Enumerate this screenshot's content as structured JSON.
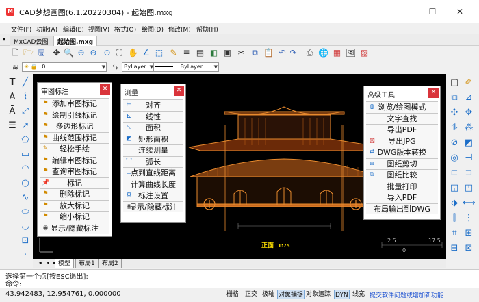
{
  "window": {
    "title": "CAD梦想画图(6.1.20220304) - 起始图.mxg",
    "minimize": "—",
    "maximize": "☐",
    "close": "✕"
  },
  "menu": [
    "文件(F)",
    "功能(A)",
    "编辑(E)",
    "视图(V)",
    "格式(O)",
    "绘图(D)",
    "修改(M)",
    "帮助(H)"
  ],
  "doc_tabs": [
    "MxCAD云图",
    "起始图.mxg"
  ],
  "layer_bar": {
    "layer_value": "0",
    "color_value": "ByLayer",
    "linetype_value": "ByLayer"
  },
  "panels": {
    "review": {
      "title": "审图标注",
      "items": [
        "添加审图标记",
        "绘制引线标记",
        "多边形标记",
        "曲线范围标记",
        "轻松手绘",
        "编辑审图标记",
        "查询审图标记",
        "标记",
        "删除标记",
        "放大标记",
        "缩小标记",
        "显示/隐藏标注"
      ]
    },
    "measure": {
      "title": "测量",
      "items": [
        "对齐",
        "线性",
        "面积",
        "矩形面积",
        "连续测量",
        "弧长",
        "点到直线距离",
        "计算曲线长度",
        "标注设置",
        "显示/隐藏标注"
      ]
    },
    "advanced": {
      "title": "高级工具",
      "items": [
        "浏览/绘图模式",
        "文字查找",
        "导出PDF",
        "导出JPG",
        "DWG版本转换",
        "图纸剪切",
        "图纸比较",
        "批量打印",
        "导入PDF",
        "布局输出到DWG"
      ]
    }
  },
  "drawing": {
    "label": "正面",
    "scale": "1:75",
    "scale_ticks": [
      "2.5",
      "0",
      "17.5"
    ]
  },
  "layout_tabs": [
    "模型",
    "布局1",
    "布局2"
  ],
  "command": {
    "history": "选择第一个点[按ESC退出]:",
    "prompt": "命令:"
  },
  "status": {
    "coords": "43.942483,  12.954761,  0.000000",
    "toggles": [
      {
        "label": "栅格",
        "on": false
      },
      {
        "label": "正交",
        "on": false
      },
      {
        "label": "极轴",
        "on": false
      },
      {
        "label": "对象捕捉",
        "on": true
      },
      {
        "label": "对象追踪",
        "on": false
      },
      {
        "label": "DYN",
        "on": true
      },
      {
        "label": "线宽",
        "on": false
      }
    ],
    "promo": "提交软件问题或增加新功能"
  },
  "colors": {
    "canvas_bg": "#000000",
    "drawing_orange": "#e88a2e",
    "drawing_label": "#ffdf00",
    "close_button": "#d9343b",
    "promo_link": "#1a4fd1"
  },
  "icons": {
    "app": "cad-logo-icon",
    "tools_left": [
      "text-icon",
      "line-icon",
      "paragraph-icon",
      "polyline-icon",
      "rectangle-icon",
      "arc-icon",
      "circle-icon",
      "spline-icon",
      "ellipse-icon",
      "hatch-icon",
      "insert-icon",
      "point-icon",
      "table-icon",
      "dimension-icon"
    ],
    "tools_right": [
      "erase-icon",
      "copy-icon",
      "mirror-icon",
      "offset-icon",
      "array-icon",
      "move-icon",
      "rotate-icon",
      "scale-icon",
      "stretch-icon",
      "trim-icon",
      "extend-icon",
      "break-icon",
      "chamfer-icon",
      "fillet-icon",
      "explode-icon"
    ]
  }
}
